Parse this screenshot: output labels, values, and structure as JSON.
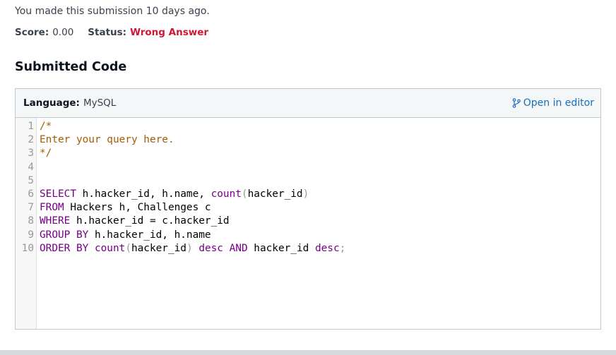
{
  "submission": {
    "time_text": "You made this submission 10 days ago.",
    "score_label": "Score:",
    "score_value": "0.00",
    "status_label": "Status:",
    "status_value": "Wrong Answer"
  },
  "section_title": "Submitted Code",
  "code_panel": {
    "language_label": "Language:",
    "language_value": "MySQL",
    "open_editor_label": "Open in editor",
    "lines": [
      {
        "num": "1",
        "tokens": [
          {
            "t": "/*",
            "c": "comment"
          }
        ]
      },
      {
        "num": "2",
        "tokens": [
          {
            "t": "Enter your query here.",
            "c": "comment"
          }
        ]
      },
      {
        "num": "3",
        "tokens": [
          {
            "t": "*/",
            "c": "comment"
          }
        ]
      },
      {
        "num": "4",
        "tokens": []
      },
      {
        "num": "5",
        "tokens": []
      },
      {
        "num": "6",
        "tokens": [
          {
            "t": "SELECT",
            "c": "kw"
          },
          {
            "t": " h.hacker_id, h.name, ",
            "c": "plain"
          },
          {
            "t": "count",
            "c": "fn"
          },
          {
            "t": "(",
            "c": "punc"
          },
          {
            "t": "hacker_id",
            "c": "plain"
          },
          {
            "t": ")",
            "c": "punc"
          }
        ]
      },
      {
        "num": "7",
        "tokens": [
          {
            "t": "FROM",
            "c": "kw"
          },
          {
            "t": " Hackers h, Challenges c",
            "c": "plain"
          }
        ]
      },
      {
        "num": "8",
        "tokens": [
          {
            "t": "WHERE",
            "c": "kw"
          },
          {
            "t": " h.hacker_id = c.hacker_id",
            "c": "plain"
          }
        ]
      },
      {
        "num": "9",
        "tokens": [
          {
            "t": "GROUP BY",
            "c": "kw"
          },
          {
            "t": " h.hacker_id, h.name",
            "c": "plain"
          }
        ]
      },
      {
        "num": "10",
        "tokens": [
          {
            "t": "ORDER BY",
            "c": "kw"
          },
          {
            "t": " ",
            "c": "plain"
          },
          {
            "t": "count",
            "c": "fn"
          },
          {
            "t": "(",
            "c": "punc"
          },
          {
            "t": "hacker_id",
            "c": "plain"
          },
          {
            "t": ")",
            "c": "punc"
          },
          {
            "t": " ",
            "c": "plain"
          },
          {
            "t": "desc",
            "c": "kw"
          },
          {
            "t": " ",
            "c": "plain"
          },
          {
            "t": "AND",
            "c": "kw"
          },
          {
            "t": " hacker_id ",
            "c": "plain"
          },
          {
            "t": "desc",
            "c": "kw"
          },
          {
            "t": ";",
            "c": "punc"
          }
        ]
      }
    ]
  },
  "colors": {
    "status_wrong": "#d11534",
    "link": "#1a6eb8",
    "keyword": "#770088",
    "comment": "#a45c06"
  },
  "icons": {
    "open_editor_icon": "branch-icon"
  }
}
